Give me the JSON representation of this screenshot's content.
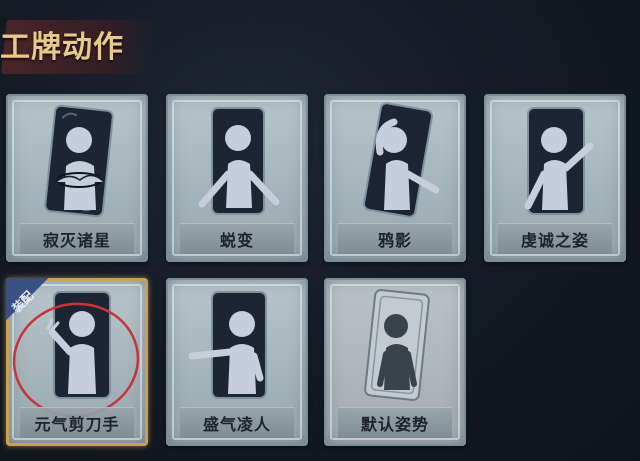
{
  "header": {
    "title": "工牌动作"
  },
  "cards": [
    {
      "name": "寂灭诸星",
      "equipped": false,
      "pose": "cross-arms"
    },
    {
      "name": "蜕变",
      "equipped": false,
      "pose": "open-arms"
    },
    {
      "name": "鸦影",
      "equipped": false,
      "pose": "hand-on-head"
    },
    {
      "name": "虔诚之姿",
      "equipped": false,
      "pose": "wave"
    },
    {
      "name": "元气剪刀手",
      "equipped": true,
      "pose": "peace-sign"
    },
    {
      "name": "盛气凌人",
      "equipped": false,
      "pose": "pointing"
    },
    {
      "name": "默认姿势",
      "equipped": false,
      "pose": "default"
    }
  ],
  "badge": {
    "equipped_label": "装配"
  },
  "colors": {
    "title": "#e8c98a",
    "card_inner": "#1d2533",
    "equipped_border": "#c9a14f",
    "equipped_circle": "#c8343a",
    "badge_bg": "#3a4f82"
  }
}
